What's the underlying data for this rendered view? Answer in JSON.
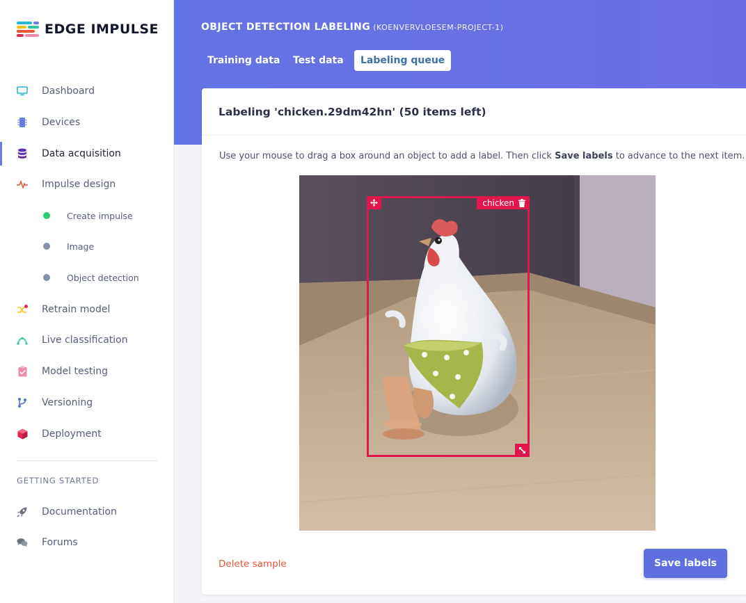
{
  "brand": {
    "name": "EDGE IMPULSE"
  },
  "sidebar": {
    "items": [
      {
        "label": "Dashboard",
        "icon": "monitor-icon",
        "color": "#29b5d6"
      },
      {
        "label": "Devices",
        "icon": "chip-icon",
        "color": "#6b79e0"
      },
      {
        "label": "Data acquisition",
        "icon": "database-icon",
        "color": "#5b2ea6",
        "active": true
      },
      {
        "label": "Impulse design",
        "icon": "pulse-icon",
        "color": "#e6573a"
      },
      {
        "label": "Retrain model",
        "icon": "shuffle-icon",
        "color": "#f2c318"
      },
      {
        "label": "Live classification",
        "icon": "curve-icon",
        "color": "#2ec4a6"
      },
      {
        "label": "Model testing",
        "icon": "clipboard-check-icon",
        "color": "#f08aa8"
      },
      {
        "label": "Versioning",
        "icon": "branch-icon",
        "color": "#4f6fd8"
      },
      {
        "label": "Deployment",
        "icon": "cube-icon",
        "color": "#e0294f"
      }
    ],
    "subitems": [
      {
        "label": "Create impulse",
        "status_color": "#2ecc71"
      },
      {
        "label": "Image",
        "status_color": "#8392a8"
      },
      {
        "label": "Object detection",
        "status_color": "#8392a8"
      }
    ],
    "section_title": "GETTING STARTED",
    "help_items": [
      {
        "label": "Documentation",
        "icon": "rocket-icon"
      },
      {
        "label": "Forums",
        "icon": "chat-icon"
      }
    ]
  },
  "header": {
    "title": "OBJECT DETECTION LABELING",
    "project": "(KOENVERVLOESEM-PROJECT-1)",
    "tabs": [
      {
        "label": "Training data"
      },
      {
        "label": "Test data"
      },
      {
        "label": "Labeling queue",
        "active": true
      }
    ]
  },
  "labeling": {
    "title": "Labeling 'chicken.29dm42hn' (50 items left)",
    "instruction_before": "Use your mouse to drag a box around an object to add a label. Then click ",
    "instruction_bold": "Save labels",
    "instruction_after": " to advance to the next item.",
    "bounding_box": {
      "label": "chicken",
      "color": "#e0174c"
    },
    "delete_label": "Delete sample",
    "save_label": "Save labels"
  },
  "colors": {
    "accent": "#5f6fe0",
    "header": "#6470e4",
    "danger": "#e6573a"
  }
}
